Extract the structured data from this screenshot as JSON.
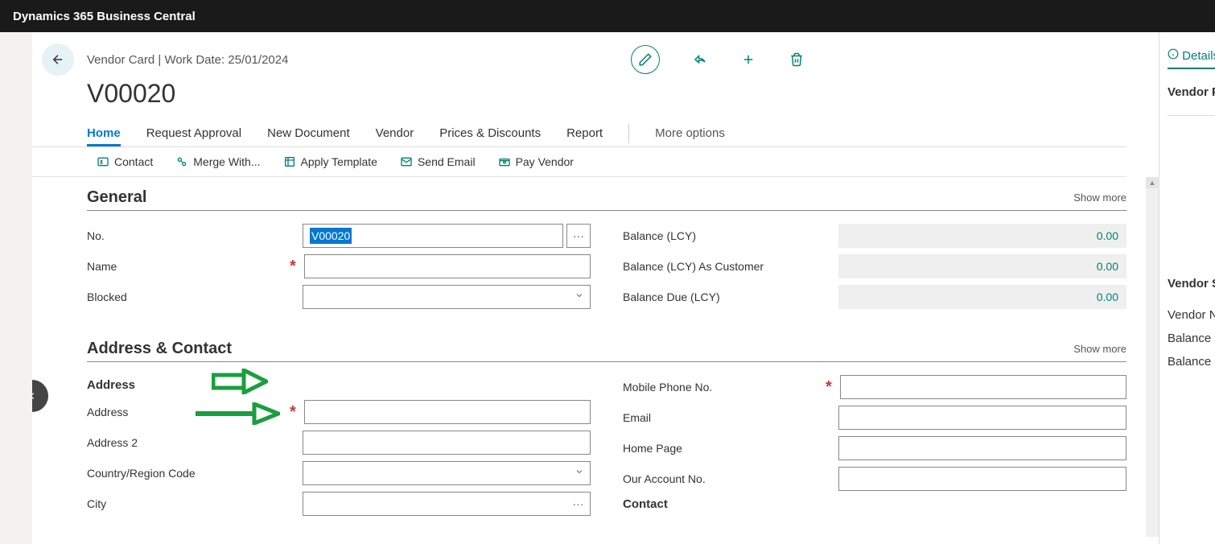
{
  "app_title": "Dynamics 365 Business Central",
  "breadcrumb": "Vendor Card | Work Date: 25/01/2024",
  "page_title": "V00020",
  "tabs": {
    "home": "Home",
    "request_approval": "Request Approval",
    "new_document": "New Document",
    "vendor": "Vendor",
    "prices_discounts": "Prices & Discounts",
    "report": "Report",
    "more_options": "More options"
  },
  "toolbar": {
    "contact": "Contact",
    "merge_with": "Merge With...",
    "apply_template": "Apply Template",
    "send_email": "Send Email",
    "pay_vendor": "Pay Vendor"
  },
  "sections": {
    "general": {
      "title": "General",
      "show_more": "Show more",
      "fields": {
        "no": {
          "label": "No.",
          "value": "V00020"
        },
        "name": {
          "label": "Name",
          "value": ""
        },
        "blocked": {
          "label": "Blocked",
          "value": ""
        },
        "balance_lcy": {
          "label": "Balance (LCY)",
          "value": "0.00"
        },
        "balance_lcy_as_customer": {
          "label": "Balance (LCY) As Customer",
          "value": "0.00"
        },
        "balance_due_lcy": {
          "label": "Balance Due (LCY)",
          "value": "0.00"
        }
      }
    },
    "address_contact": {
      "title": "Address & Contact",
      "show_more": "Show more",
      "address_heading": "Address",
      "contact_heading": "Contact",
      "fields": {
        "address": {
          "label": "Address",
          "value": ""
        },
        "address2": {
          "label": "Address 2",
          "value": ""
        },
        "country": {
          "label": "Country/Region Code",
          "value": ""
        },
        "city": {
          "label": "City",
          "value": ""
        },
        "mobile": {
          "label": "Mobile Phone No.",
          "value": ""
        },
        "email": {
          "label": "Email",
          "value": ""
        },
        "home_page": {
          "label": "Home Page",
          "value": ""
        },
        "our_account": {
          "label": "Our Account No.",
          "value": ""
        }
      }
    }
  },
  "side_panel": {
    "details": "Details",
    "vendor_picture": "Vendor Picture",
    "vendor_stats": "Vendor Statistics",
    "vendor_no": "Vendor No.",
    "balance": "Balance (LCY)",
    "balance2": "Balance"
  }
}
